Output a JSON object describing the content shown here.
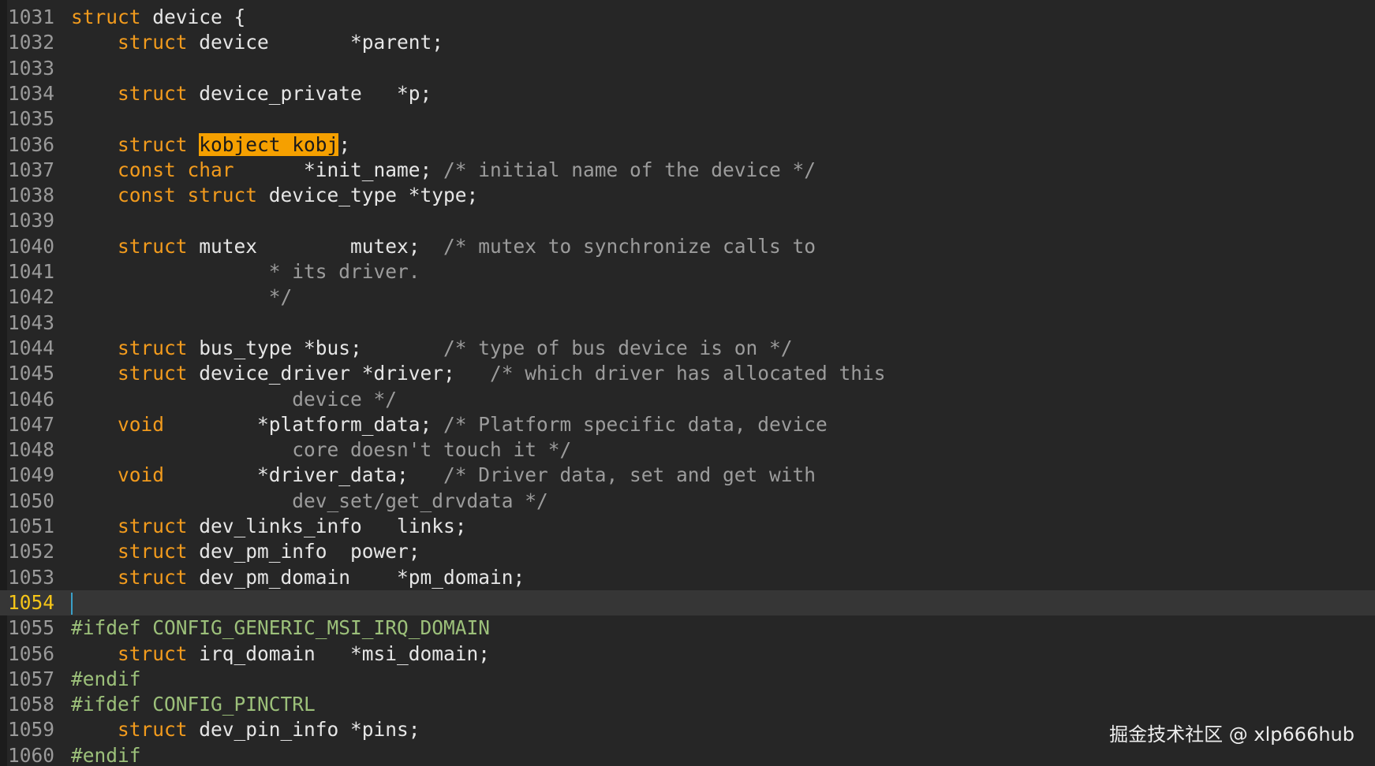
{
  "editor": {
    "language": "c",
    "current_line": "1054",
    "colors": {
      "background": "#262626",
      "keyword": "#f29b1d",
      "identifier": "#e6e6e6",
      "comment": "#9c9c9c",
      "preprocessor": "#9cc07a",
      "search_highlight": "#f5a000",
      "current_line_bg": "#363636",
      "current_line_number": "#f5c518",
      "caret": "#3aa0c8"
    },
    "lines": [
      {
        "number": "1031",
        "tokens": [
          {
            "type": "keyword",
            "text": "struct"
          },
          {
            "type": "ident",
            "text": " device {"
          }
        ]
      },
      {
        "number": "1032",
        "tokens": [
          {
            "type": "ident",
            "text": "    "
          },
          {
            "type": "keyword",
            "text": "struct"
          },
          {
            "type": "ident",
            "text": " device       *parent;"
          }
        ]
      },
      {
        "number": "1033",
        "tokens": []
      },
      {
        "number": "1034",
        "tokens": [
          {
            "type": "ident",
            "text": "    "
          },
          {
            "type": "keyword",
            "text": "struct"
          },
          {
            "type": "ident",
            "text": " device_private   *p;"
          }
        ]
      },
      {
        "number": "1035",
        "tokens": []
      },
      {
        "number": "1036",
        "tokens": [
          {
            "type": "ident",
            "text": "    "
          },
          {
            "type": "keyword",
            "text": "struct"
          },
          {
            "type": "ident",
            "text": " "
          },
          {
            "type": "highlight",
            "text": "kobject kobj"
          },
          {
            "type": "ident",
            "text": ";"
          }
        ]
      },
      {
        "number": "1037",
        "tokens": [
          {
            "type": "ident",
            "text": "    "
          },
          {
            "type": "keyword",
            "text": "const char"
          },
          {
            "type": "ident",
            "text": "      *init_name; "
          },
          {
            "type": "comment",
            "text": "/* initial name of the device */"
          }
        ]
      },
      {
        "number": "1038",
        "tokens": [
          {
            "type": "ident",
            "text": "    "
          },
          {
            "type": "keyword",
            "text": "const struct"
          },
          {
            "type": "ident",
            "text": " device_type *type;"
          }
        ]
      },
      {
        "number": "1039",
        "tokens": []
      },
      {
        "number": "1040",
        "tokens": [
          {
            "type": "ident",
            "text": "    "
          },
          {
            "type": "keyword",
            "text": "struct"
          },
          {
            "type": "ident",
            "text": " mutex        mutex;  "
          },
          {
            "type": "comment",
            "text": "/* mutex to synchronize calls to"
          }
        ]
      },
      {
        "number": "1041",
        "tokens": [
          {
            "type": "comment",
            "text": "                 * its driver."
          }
        ]
      },
      {
        "number": "1042",
        "tokens": [
          {
            "type": "comment",
            "text": "                 */"
          }
        ]
      },
      {
        "number": "1043",
        "tokens": []
      },
      {
        "number": "1044",
        "tokens": [
          {
            "type": "ident",
            "text": "    "
          },
          {
            "type": "keyword",
            "text": "struct"
          },
          {
            "type": "ident",
            "text": " bus_type *bus;       "
          },
          {
            "type": "comment",
            "text": "/* type of bus device is on */"
          }
        ]
      },
      {
        "number": "1045",
        "tokens": [
          {
            "type": "ident",
            "text": "    "
          },
          {
            "type": "keyword",
            "text": "struct"
          },
          {
            "type": "ident",
            "text": " device_driver *driver;   "
          },
          {
            "type": "comment",
            "text": "/* which driver has allocated this"
          }
        ]
      },
      {
        "number": "1046",
        "tokens": [
          {
            "type": "comment",
            "text": "                   device */"
          }
        ]
      },
      {
        "number": "1047",
        "tokens": [
          {
            "type": "ident",
            "text": "    "
          },
          {
            "type": "keyword",
            "text": "void"
          },
          {
            "type": "ident",
            "text": "        *platform_data; "
          },
          {
            "type": "comment",
            "text": "/* Platform specific data, device"
          }
        ]
      },
      {
        "number": "1048",
        "tokens": [
          {
            "type": "comment",
            "text": "                   core doesn't touch it */"
          }
        ]
      },
      {
        "number": "1049",
        "tokens": [
          {
            "type": "ident",
            "text": "    "
          },
          {
            "type": "keyword",
            "text": "void"
          },
          {
            "type": "ident",
            "text": "        *driver_data;   "
          },
          {
            "type": "comment",
            "text": "/* Driver data, set and get with"
          }
        ]
      },
      {
        "number": "1050",
        "tokens": [
          {
            "type": "comment",
            "text": "                   dev_set/get_drvdata */"
          }
        ]
      },
      {
        "number": "1051",
        "tokens": [
          {
            "type": "ident",
            "text": "    "
          },
          {
            "type": "keyword",
            "text": "struct"
          },
          {
            "type": "ident",
            "text": " dev_links_info   links;"
          }
        ]
      },
      {
        "number": "1052",
        "tokens": [
          {
            "type": "ident",
            "text": "    "
          },
          {
            "type": "keyword",
            "text": "struct"
          },
          {
            "type": "ident",
            "text": " dev_pm_info  power;"
          }
        ]
      },
      {
        "number": "1053",
        "tokens": [
          {
            "type": "ident",
            "text": "    "
          },
          {
            "type": "keyword",
            "text": "struct"
          },
          {
            "type": "ident",
            "text": " dev_pm_domain    *pm_domain;"
          }
        ]
      },
      {
        "number": "1054",
        "tokens": [],
        "current": true
      },
      {
        "number": "1055",
        "tokens": [
          {
            "type": "preproc",
            "text": "#ifdef CONFIG_GENERIC_MSI_IRQ_DOMAIN"
          }
        ]
      },
      {
        "number": "1056",
        "tokens": [
          {
            "type": "ident",
            "text": "    "
          },
          {
            "type": "keyword",
            "text": "struct"
          },
          {
            "type": "ident",
            "text": " irq_domain   *msi_domain;"
          }
        ]
      },
      {
        "number": "1057",
        "tokens": [
          {
            "type": "preproc",
            "text": "#endif"
          }
        ]
      },
      {
        "number": "1058",
        "tokens": [
          {
            "type": "preproc",
            "text": "#ifdef CONFIG_PINCTRL"
          }
        ]
      },
      {
        "number": "1059",
        "tokens": [
          {
            "type": "ident",
            "text": "    "
          },
          {
            "type": "keyword",
            "text": "struct"
          },
          {
            "type": "ident",
            "text": " dev_pin_info *pins;"
          }
        ]
      },
      {
        "number": "1060",
        "tokens": [
          {
            "type": "preproc",
            "text": "#endif"
          }
        ]
      }
    ]
  },
  "watermark": {
    "text": "掘金技术社区 @ xlp666hub"
  }
}
